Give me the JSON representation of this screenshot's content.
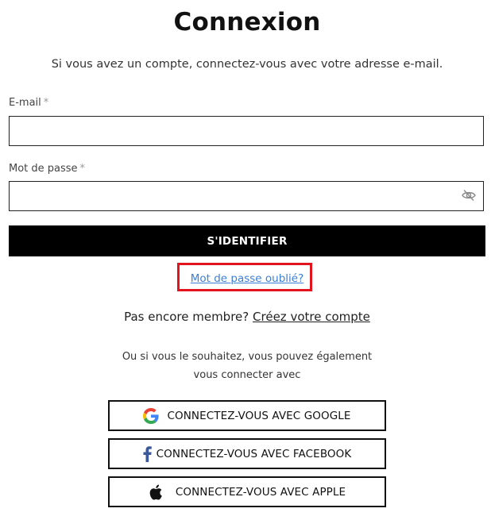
{
  "header": {
    "title": "Connexion",
    "subtitle": "Si vous avez un compte, connectez-vous avec votre adresse e-mail."
  },
  "form": {
    "email_label": "E-mail",
    "password_label": "Mot de passe",
    "required_mark": "*",
    "email_value": "",
    "password_value": "",
    "submit_label": "S'IDENTIFIER",
    "forgot_label": "Mot de passe oublié?"
  },
  "signup": {
    "prompt": "Pas encore membre?",
    "link": "Créez votre compte"
  },
  "social": {
    "intro_line1": "Ou si vous le souhaitez, vous pouvez également",
    "intro_line2": "vous connecter avec",
    "buttons": [
      {
        "label": "CONNECTEZ-VOUS AVEC GOOGLE",
        "icon": "google-icon"
      },
      {
        "label": "CONNECTEZ-VOUS AVEC FACEBOOK",
        "icon": "facebook-icon"
      },
      {
        "label": "CONNECTEZ-VOUS AVEC APPLE",
        "icon": "apple-icon"
      }
    ]
  },
  "colors": {
    "highlight_border": "#e3141d",
    "link_blue": "#3d7fd6",
    "submit_bg": "#000000"
  }
}
